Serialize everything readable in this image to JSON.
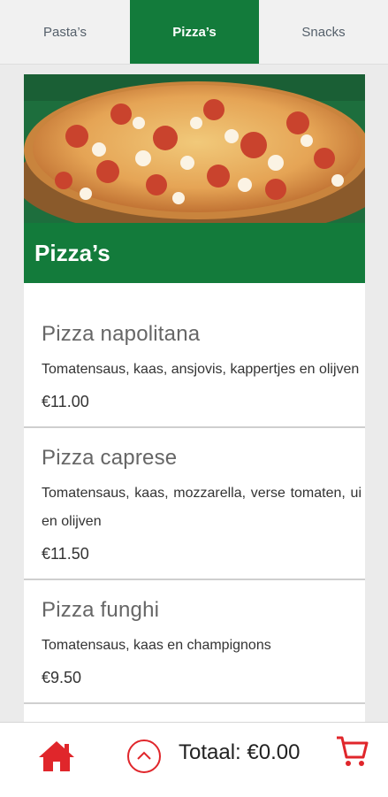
{
  "tabs": [
    {
      "label": "Pasta’s"
    },
    {
      "label": "Pizza’s"
    },
    {
      "label": "Snacks"
    }
  ],
  "active_tab": "Pizza’s",
  "section": {
    "title": "Pizza’s",
    "image": "pizza-photo"
  },
  "items": [
    {
      "name": "Pizza napolitana",
      "description": "Tomatensaus, kaas, ansjovis, kappertjes en olijven",
      "price": "€11.00"
    },
    {
      "name": "Pizza caprese",
      "description": "Tomatensaus, kaas, mozzarella, verse tomaten, ui en olijven",
      "price": "€11.50"
    },
    {
      "name": "Pizza funghi",
      "description": "Tomatensaus, kaas en champignons",
      "price": "€9.50"
    }
  ],
  "footer": {
    "total": "Totaal: €0.00",
    "home_icon": "home-icon",
    "up_icon": "chevron-up-icon",
    "cart_icon": "cart-icon"
  },
  "colors": {
    "brand_green": "#137b3b",
    "accent_red": "#e0262b"
  }
}
